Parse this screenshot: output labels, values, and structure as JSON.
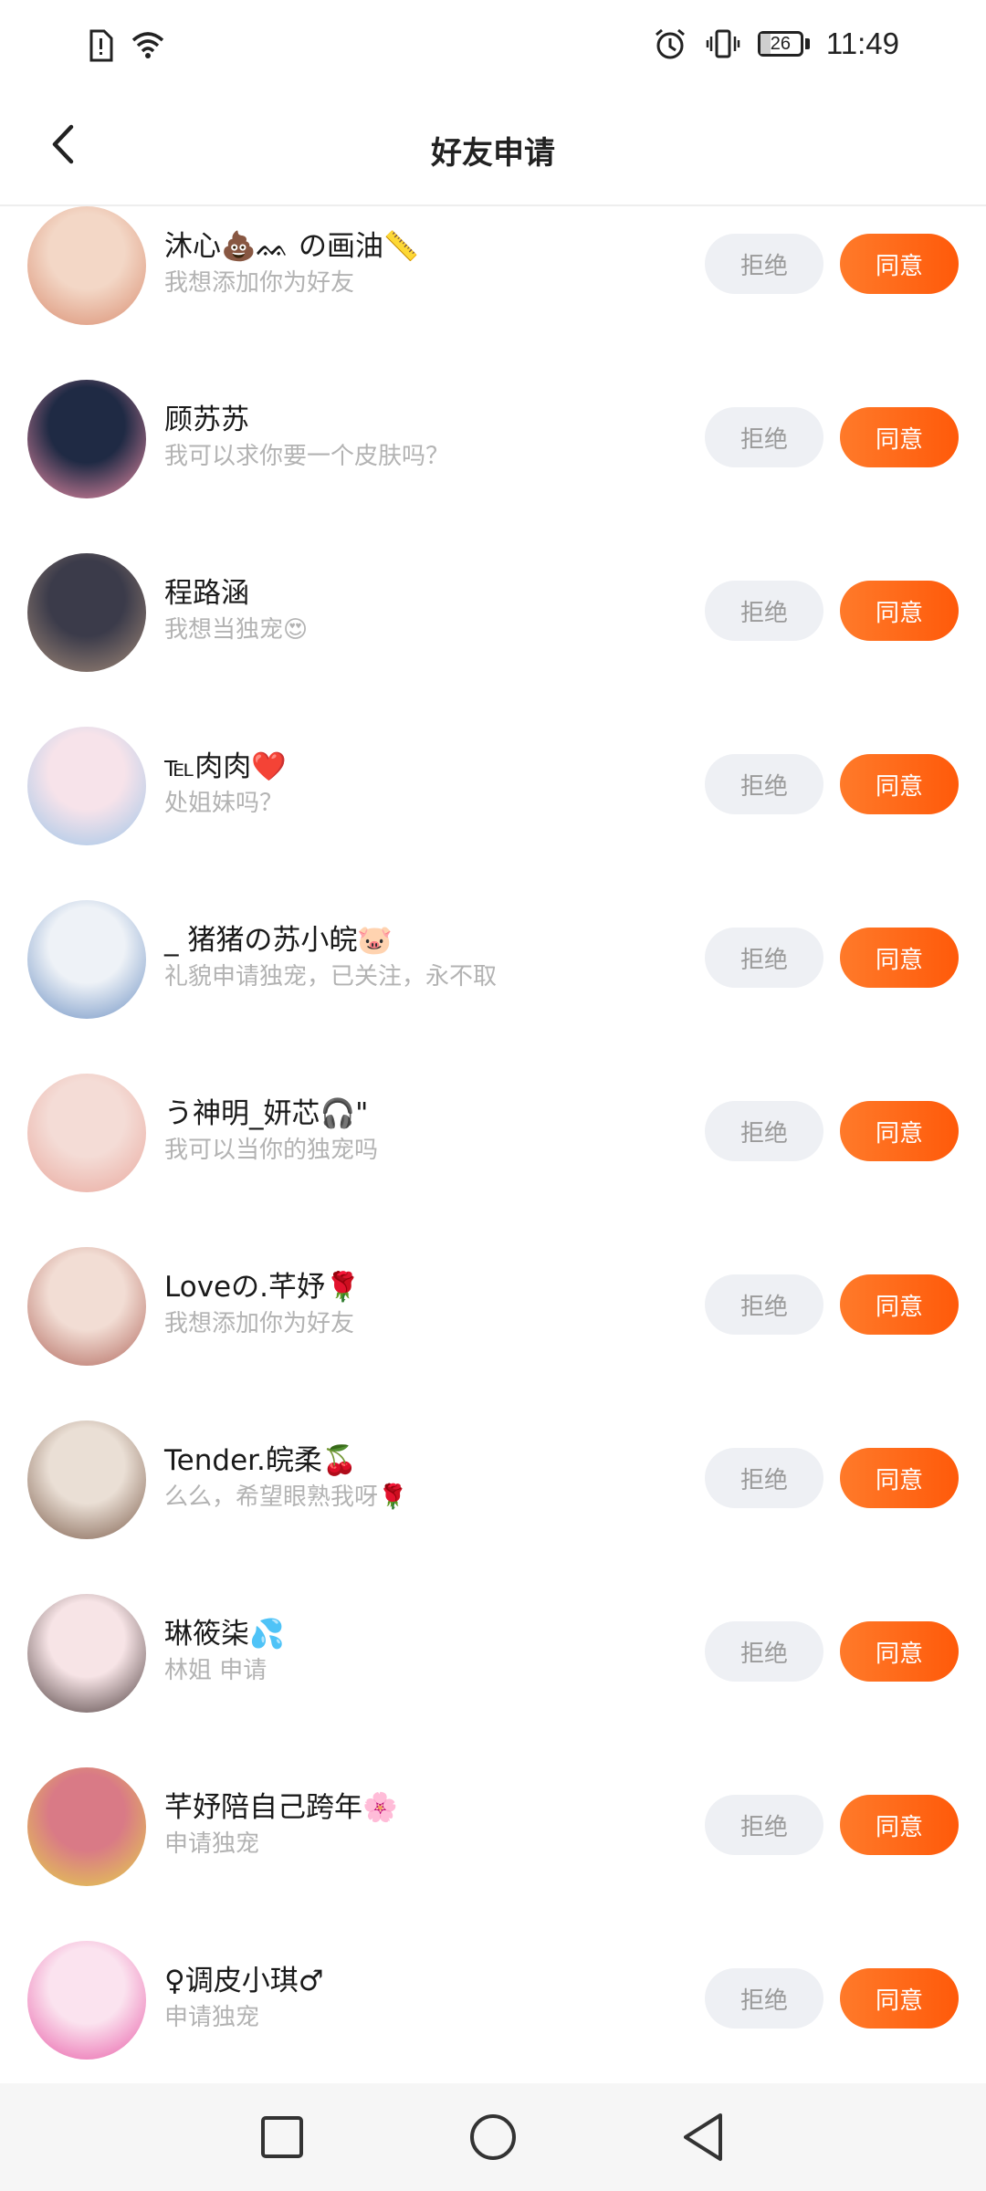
{
  "status_bar": {
    "time": "11:49",
    "battery_level": "26",
    "battery_fraction": 0.26,
    "icons_left": [
      "sim-alert-icon",
      "wifi-icon"
    ],
    "icons_right": [
      "alarm-icon",
      "vibrate-icon",
      "battery-icon"
    ]
  },
  "header": {
    "title": "好友申请",
    "back_icon": "chevron-left-icon"
  },
  "requests": [
    {
      "name": "沐心💩ᨐ の画油📏",
      "message": "我想添加你为好友",
      "avatar_colors": [
        "#f3d7c6",
        "#d98c6f"
      ]
    },
    {
      "name": "顾苏苏",
      "message": "我可以求你要一个皮肤吗？",
      "avatar_colors": [
        "#1f2a44",
        "#f08fa8"
      ]
    },
    {
      "name": "程路涵",
      "message": "我想当独宠😍",
      "avatar_colors": [
        "#3b3b4a",
        "#a58c7a"
      ]
    },
    {
      "name": "℡肉肉❤️",
      "message": "处姐妹吗？",
      "avatar_colors": [
        "#f7e3ea",
        "#9ec5e8"
      ]
    },
    {
      "name": "_ 猪猪の苏小皖🐷",
      "message": "礼貌申请独宠，已关注，永不取",
      "avatar_colors": [
        "#eef2f7",
        "#6b8fc2"
      ]
    },
    {
      "name": "う神明_妍芯🎧\"",
      "message": "我可以当你的独宠吗",
      "avatar_colors": [
        "#f4dcd6",
        "#e9a79c"
      ]
    },
    {
      "name": "Loveの.芊妤🌹",
      "message": "我想添加你为好友",
      "avatar_colors": [
        "#f2ddd4",
        "#b0655a"
      ]
    },
    {
      "name": "Tender.皖柔🍒",
      "message": "么么，希望眼熟我呀🌹",
      "avatar_colors": [
        "#eadfd5",
        "#7a5a48"
      ]
    },
    {
      "name": "琳筱柒💦",
      "message": "林姐  申请",
      "avatar_colors": [
        "#f7e4e6",
        "#4a3a3a"
      ]
    },
    {
      "name": "芊妤陪自己跨年🌸",
      "message": "申请独宠",
      "avatar_colors": [
        "#d97a86",
        "#e5d24a"
      ]
    },
    {
      "name": "♀调皮小琪♂",
      "message": "申请独宠",
      "avatar_colors": [
        "#fbe3ef",
        "#e85aa6"
      ]
    }
  ],
  "buttons": {
    "reject": "拒绝",
    "accept": "同意"
  },
  "nav_bar": {
    "icons": [
      "recent-apps-icon",
      "home-icon",
      "back-icon"
    ]
  }
}
